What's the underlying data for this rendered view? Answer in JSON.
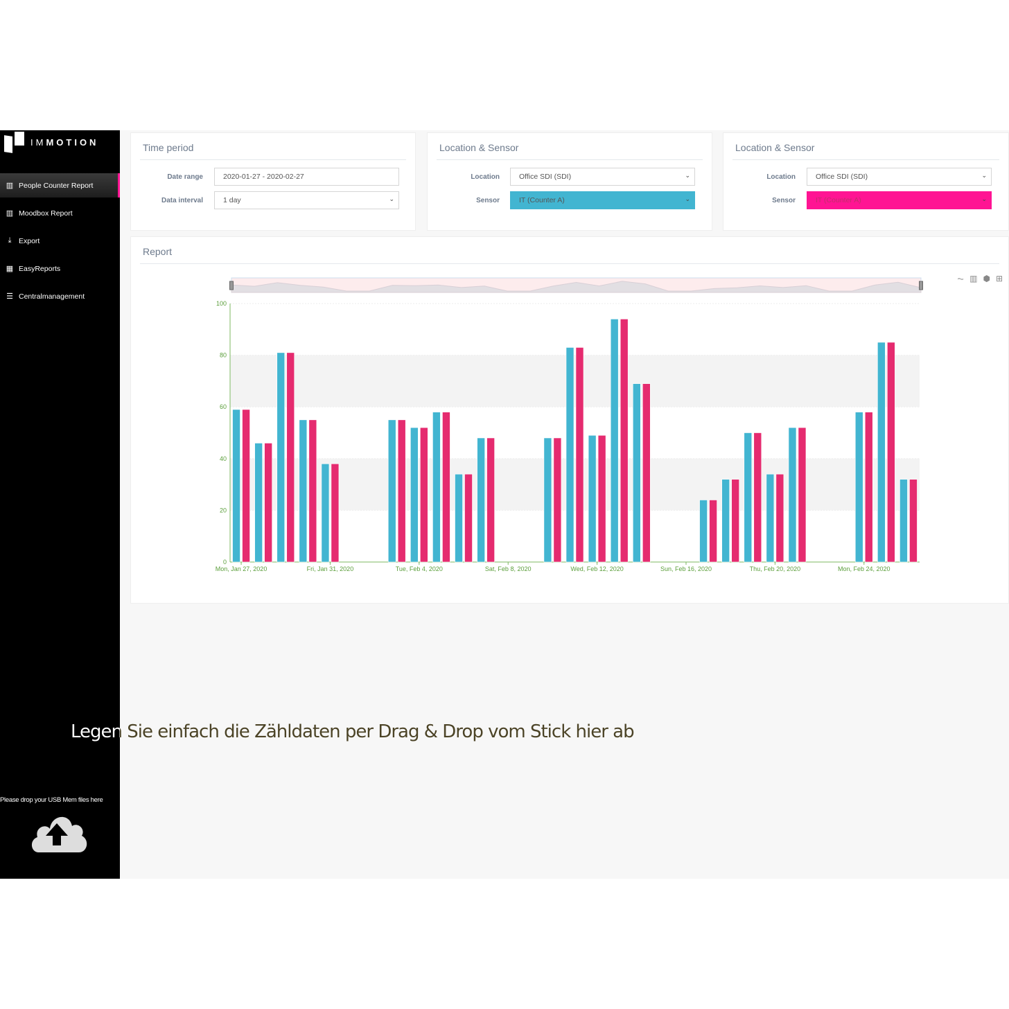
{
  "sidebar": {
    "logo": "IMMOTION",
    "items": [
      {
        "label": "People Counter Report",
        "icon": "bar-chart-icon",
        "active": true
      },
      {
        "label": "Moodbox Report",
        "icon": "bar-chart-icon"
      },
      {
        "label": "Export",
        "icon": "download-icon"
      },
      {
        "label": "EasyReports",
        "icon": "qr-grid-icon"
      },
      {
        "label": "Centralmanagement",
        "icon": "server-icon"
      }
    ],
    "drop_text": "Please drop your USB Mem files here"
  },
  "time_period": {
    "title": "Time period",
    "date_range_label": "Date range",
    "date_range": "2020-01-27 - 2020-02-27",
    "interval_label": "Data interval",
    "interval": "1 day"
  },
  "loc1": {
    "title": "Location & Sensor",
    "location_label": "Location",
    "location": "Office SDI (SDI)",
    "sensor_label": "Sensor",
    "sensor": "IT (Counter A)",
    "color": "#3fb4d3"
  },
  "loc2": {
    "title": "Location & Sensor",
    "location_label": "Location",
    "location": "Office SDI (SDI)",
    "sensor_label": "Sensor",
    "sensor": "IT (Counter A)",
    "color": "#ff1493"
  },
  "report": {
    "title": "Report",
    "tools": [
      "line-chart-icon",
      "bar-chart-icon",
      "3d-box-icon",
      "grid-icon"
    ]
  },
  "overlay_text": "Legen Sie einfach die Zähldaten per Drag & Drop vom Stick hier ab",
  "chart_data": {
    "type": "bar",
    "categories": [
      "2020-01-27",
      "2020-01-28",
      "2020-01-29",
      "2020-01-30",
      "2020-01-31",
      "2020-02-01",
      "2020-02-02",
      "2020-02-03",
      "2020-02-04",
      "2020-02-05",
      "2020-02-06",
      "2020-02-07",
      "2020-02-08",
      "2020-02-09",
      "2020-02-10",
      "2020-02-11",
      "2020-02-12",
      "2020-02-13",
      "2020-02-14",
      "2020-02-15",
      "2020-02-16",
      "2020-02-17",
      "2020-02-18",
      "2020-02-19",
      "2020-02-20",
      "2020-02-21",
      "2020-02-22",
      "2020-02-23",
      "2020-02-24",
      "2020-02-25",
      "2020-02-26"
    ],
    "series": [
      {
        "color": "#42b5d1",
        "values": [
          59,
          46,
          81,
          55,
          38,
          0,
          0,
          55,
          52,
          58,
          34,
          48,
          0,
          0,
          48,
          83,
          49,
          94,
          69,
          0,
          0,
          24,
          32,
          50,
          34,
          52,
          0,
          0,
          58,
          85,
          32
        ]
      },
      {
        "color": "#e52b6f",
        "values": [
          59,
          46,
          81,
          55,
          38,
          0,
          0,
          55,
          52,
          58,
          34,
          48,
          0,
          0,
          48,
          83,
          49,
          94,
          69,
          0,
          0,
          24,
          32,
          50,
          34,
          52,
          0,
          0,
          58,
          85,
          32
        ]
      }
    ],
    "xtick_labels": [
      "Mon, Jan 27, 2020",
      "Fri, Jan 31, 2020",
      "Tue, Feb 4, 2020",
      "Sat, Feb 8, 2020",
      "Wed, Feb 12, 2020",
      "Sun, Feb 16, 2020",
      "Thu, Feb 20, 2020",
      "Mon, Feb 24, 2020"
    ],
    "yticks": [
      0,
      20,
      40,
      60,
      80,
      100
    ],
    "ylim": [
      0,
      100
    ],
    "grid": "alternating bands",
    "navigator": true
  }
}
